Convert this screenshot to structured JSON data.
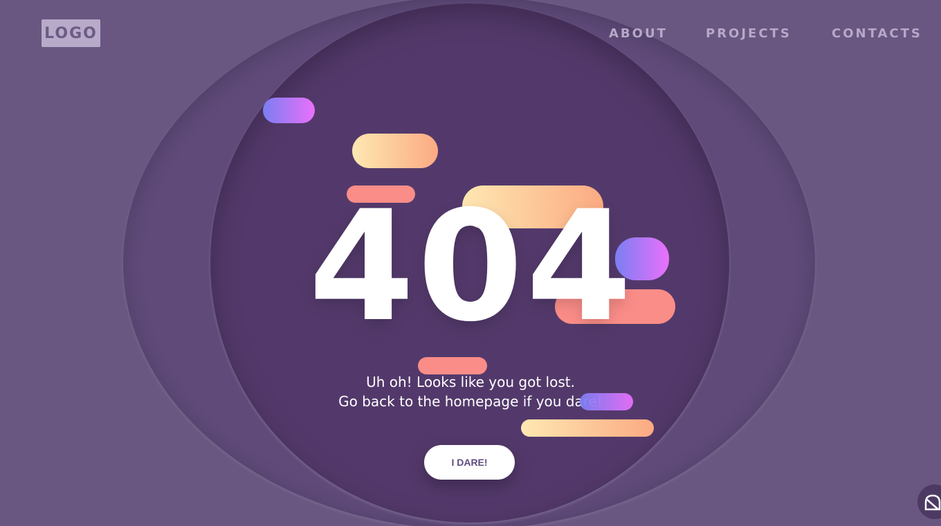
{
  "header": {
    "logo_text": "LOGO",
    "nav": [
      {
        "label": "ABOUT"
      },
      {
        "label": "PROJECTS"
      },
      {
        "label": "CONTACTS"
      }
    ]
  },
  "main": {
    "error_code": "404",
    "message_line1": "Uh oh! Looks like you got lost.",
    "message_line2": "Go back to the homepage if you dare!",
    "button_label": "I DARE!"
  },
  "colors": {
    "background": "#695681",
    "outer_circle": "#5f4a79",
    "inner_circle": "#53396b",
    "accent_purple_start": "#7b7ef2",
    "accent_purple_end": "#ea70fb",
    "accent_peach_start": "#fee8b2",
    "accent_peach_end": "#fbaa82",
    "accent_coral": "#fb8d88"
  },
  "icons": {
    "corner_icon": "bell-icon"
  }
}
